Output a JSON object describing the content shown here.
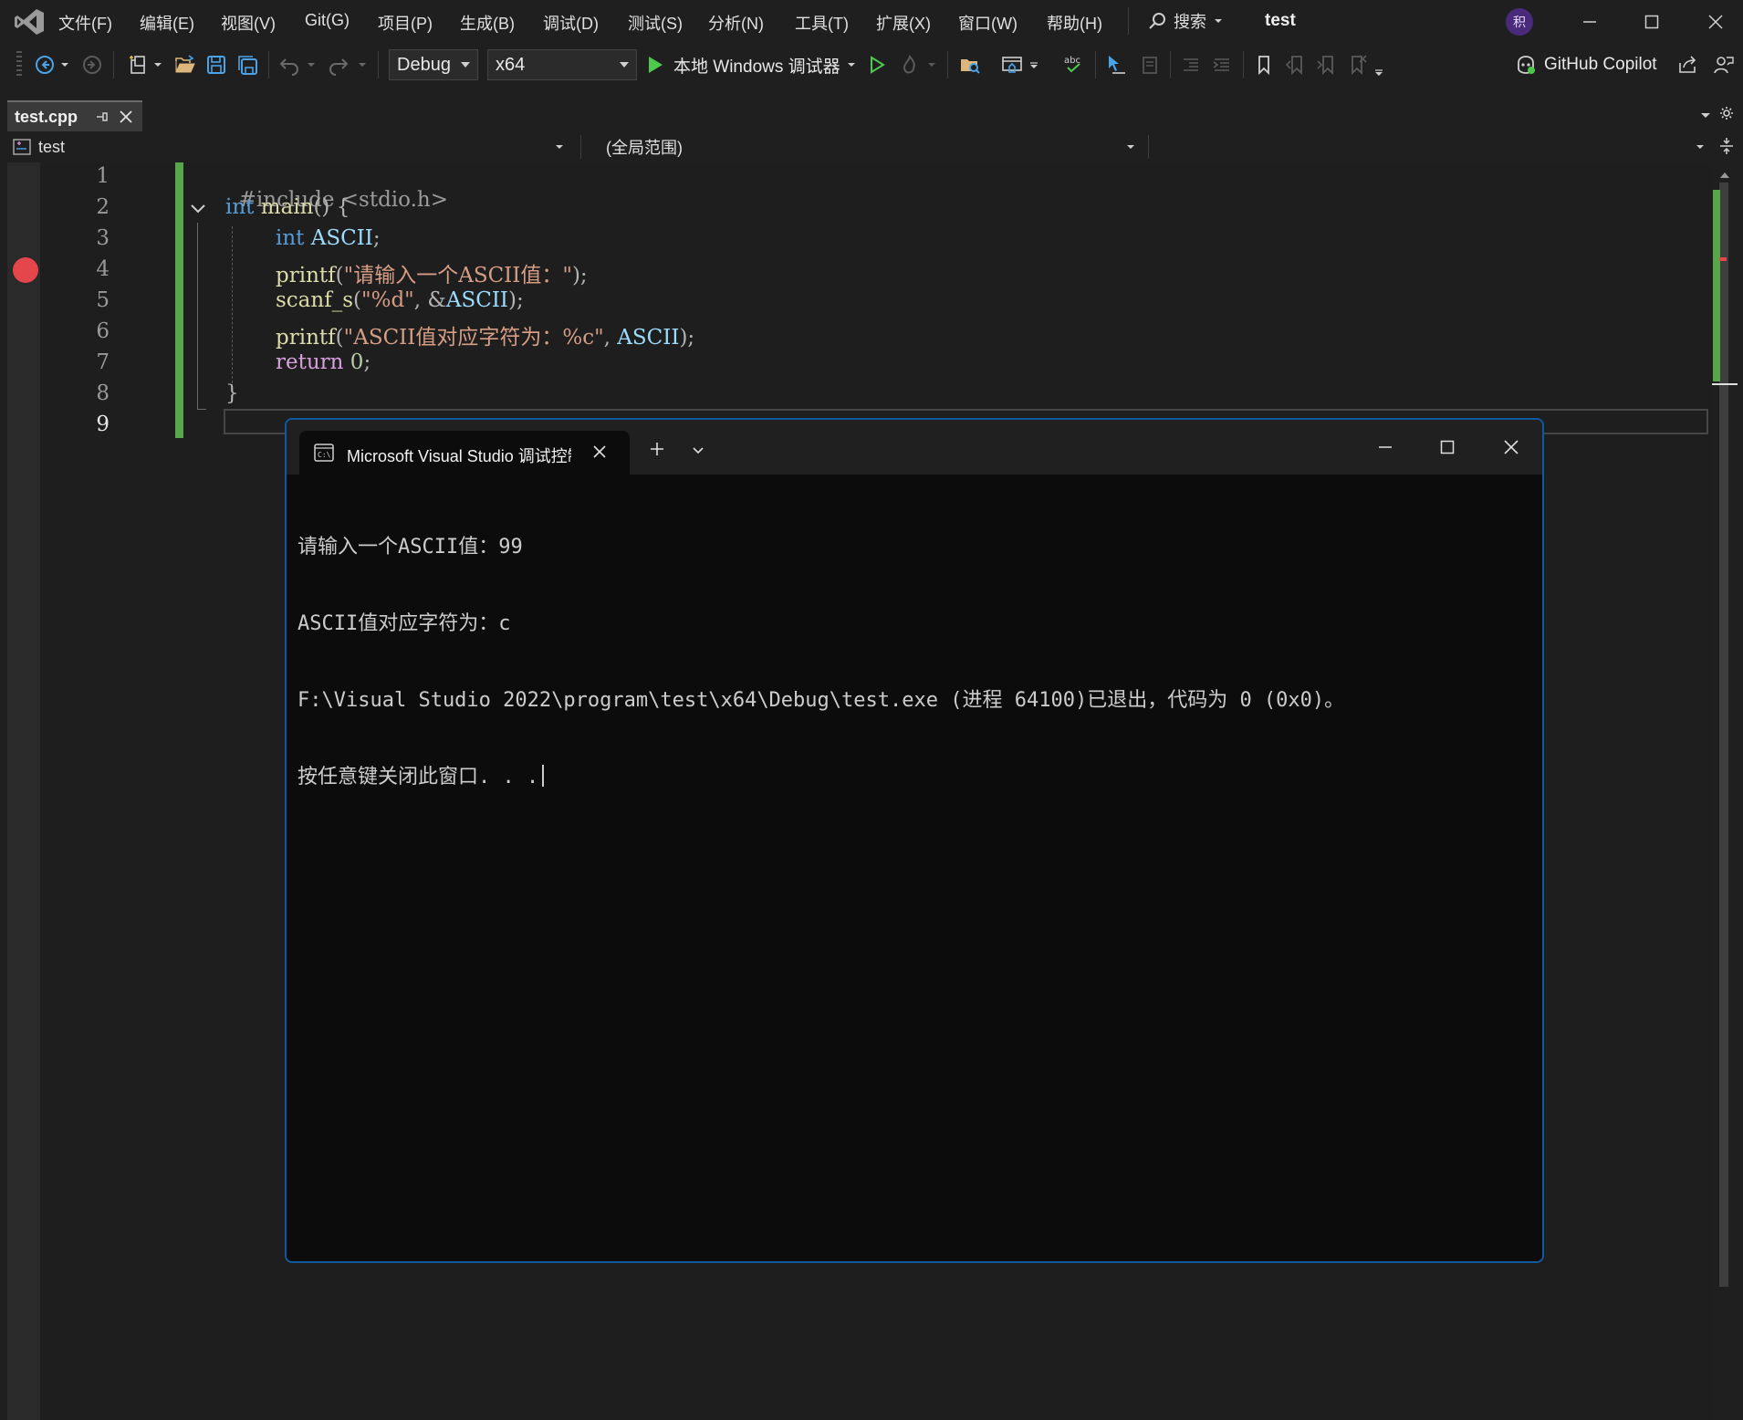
{
  "window": {
    "project_title": "test",
    "avatar_text": "积"
  },
  "menu": {
    "items": [
      "文件(F)",
      "编辑(E)",
      "视图(V)",
      "Git(G)",
      "项目(P)",
      "生成(B)",
      "调试(D)",
      "测试(S)",
      "分析(N)",
      "工具(T)",
      "扩展(X)",
      "窗口(W)",
      "帮助(H)"
    ],
    "search_label": "搜索"
  },
  "toolbar": {
    "configuration": "Debug",
    "platform": "x64",
    "run_label": "本地 Windows 调试器",
    "copilot_label": "GitHub Copilot"
  },
  "document": {
    "tab_label": "test.cpp",
    "nav_project": "test",
    "nav_scope": "(全局范围)"
  },
  "editor": {
    "line_numbers": [
      "1",
      "2",
      "3",
      "4",
      "5",
      "6",
      "7",
      "8",
      "9"
    ],
    "code": {
      "l1_pp": "#include <stdio.h>",
      "l2_kw": "int",
      "l2_fn": "main",
      "l2_rest": "() {",
      "l3_kw": "int",
      "l3_var": "ASCII",
      "l3_rest": ";",
      "l4_fn": "printf",
      "l4_open": "(",
      "l4_str": "\"请输入一个ASCII值：\"",
      "l4_close": ");",
      "l5_fn": "scanf_s",
      "l5_open": "(",
      "l5_str": "\"%d\"",
      "l5_mid": ", &",
      "l5_var": "ASCII",
      "l5_close": ");",
      "l6_fn": "printf",
      "l6_open": "(",
      "l6_str": "\"ASCII值对应字符为：%c\"",
      "l6_mid": ", ",
      "l6_var": "ASCII",
      "l6_close": ");",
      "l7_kw": "return",
      "l7_num": "0",
      "l7_rest": ";",
      "l8": "}"
    }
  },
  "console": {
    "tab_title": "Microsoft Visual Studio 调试控制台",
    "lines": [
      "请输入一个ASCII值：99",
      "ASCII值对应字符为：c",
      "F:\\Visual Studio 2022\\program\\test\\x64\\Debug\\test.exe (进程 64100)已退出，代码为 0 (0x0)。",
      "按任意键关闭此窗口. . ."
    ]
  },
  "colors": {
    "accent_blue": "#0f5a9e",
    "breakpoint_red": "#e5464b",
    "change_green": "#57a64a"
  }
}
